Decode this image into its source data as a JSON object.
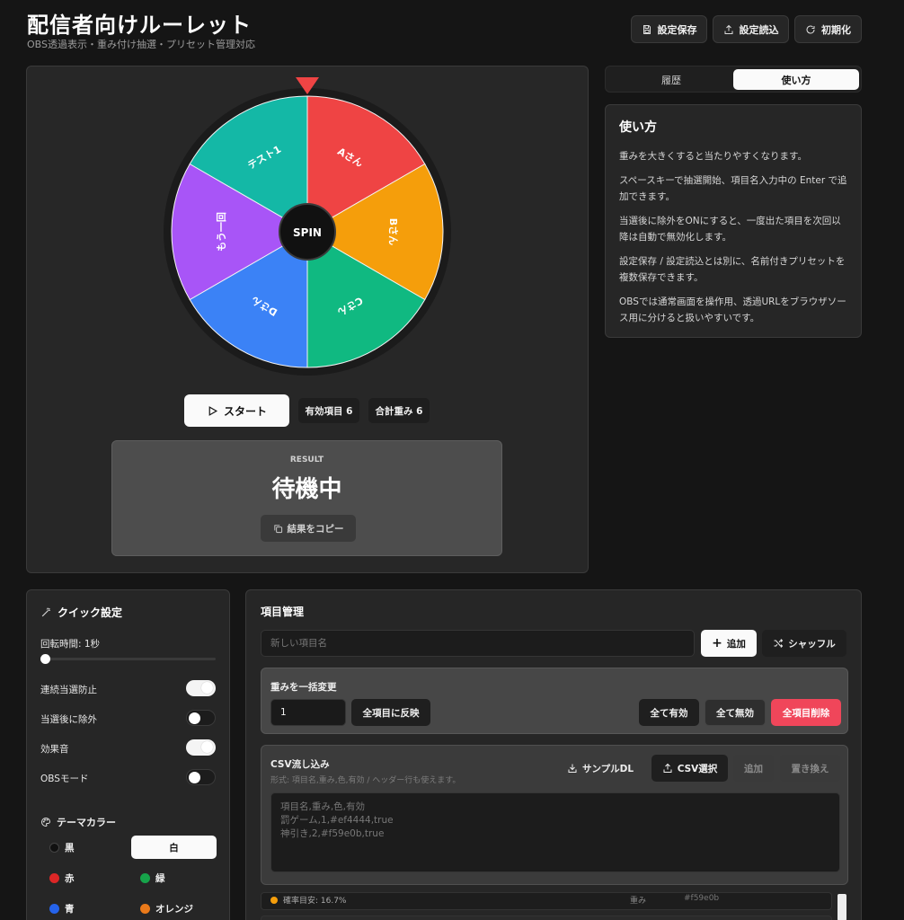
{
  "header": {
    "title": "配信者向けルーレット",
    "subtitle": "OBS透過表示・重み付け抽選・プリセット管理対応",
    "save_label": "設定保存",
    "load_label": "設定読込",
    "reset_label": "初期化"
  },
  "wheel": {
    "center_label": "SPIN",
    "segments": [
      {
        "label": "Aさん",
        "color": "#ef4444"
      },
      {
        "label": "Bさん",
        "color": "#f59e0b"
      },
      {
        "label": "Cさん",
        "color": "#10b981"
      },
      {
        "label": "Dさん",
        "color": "#3b82f6"
      },
      {
        "label": "もう一回",
        "color": "#a855f7"
      },
      {
        "label": "テスト1",
        "color": "#14b8a6"
      }
    ],
    "pointer_color": "#ef4444"
  },
  "controls": {
    "start_label": "スタート",
    "enabled_count": "有効項目 6",
    "total_weight": "合計重み 6"
  },
  "result": {
    "label": "RESULT",
    "value": "待機中",
    "copy_label": "結果をコピー"
  },
  "tabs": {
    "history": "履歴",
    "howto": "使い方"
  },
  "howto": {
    "title": "使い方",
    "p1": "重みを大きくすると当たりやすくなります。",
    "p2": "スペースキーで抽選開始、項目名入力中の Enter で追加できます。",
    "p3": "当選後に除外をONにすると、一度出た項目を次回以降は自動で無効化します。",
    "p4": "設定保存 / 設定読込とは別に、名前付きプリセットを複数保存できます。",
    "p5": "OBSでは通常画面を操作用、透過URLをブラウザソース用に分けると扱いやすいです。"
  },
  "quick": {
    "title": "クイック設定",
    "spin_time_label": "回転時間: 1秒",
    "spin_time_value": 0.0,
    "no_repeat_label": "連続当選防止",
    "no_repeat_on": true,
    "exclude_label": "当選後に除外",
    "exclude_on": false,
    "sound_label": "効果音",
    "sound_on": true,
    "obs_label": "OBSモード",
    "obs_on": false,
    "theme_title": "テーマカラー",
    "themes": [
      {
        "label": "黒",
        "color": "#111111",
        "selected": false
      },
      {
        "label": "白",
        "color": "#ffffff",
        "selected": true
      },
      {
        "label": "赤",
        "color": "#dc2626",
        "selected": false
      },
      {
        "label": "緑",
        "color": "#16a34a",
        "selected": false
      },
      {
        "label": "青",
        "color": "#2563eb",
        "selected": false
      },
      {
        "label": "オレンジ",
        "color": "#ea7a1a",
        "selected": false
      }
    ]
  },
  "items": {
    "title": "項目管理",
    "new_placeholder": "新しい項目名",
    "add_label": "追加",
    "shuffle_label": "シャッフル",
    "bulk_title": "重みを一括変更",
    "bulk_value": "1",
    "apply_label": "全項目に反映",
    "enable_all": "全て有効",
    "disable_all": "全て無効",
    "delete_all": "全項目削除",
    "csv_title": "CSV流し込み",
    "csv_hint": "形式: 項目名,重み,色,有効 / ヘッダー行も使えます。",
    "sample_dl": "サンプルDL",
    "csv_select": "CSV選択",
    "csv_add": "追加",
    "csv_replace": "置き換え",
    "csv_placeholder": "項目名,重み,色,有効\n罰ゲーム,1,#ef4444,true\n神引き,2,#f59e0b,true",
    "row_partial_prob": "確率目安: 16.7%",
    "row_partial_weight": "重み",
    "row_partial_color": "#f59e0b"
  }
}
